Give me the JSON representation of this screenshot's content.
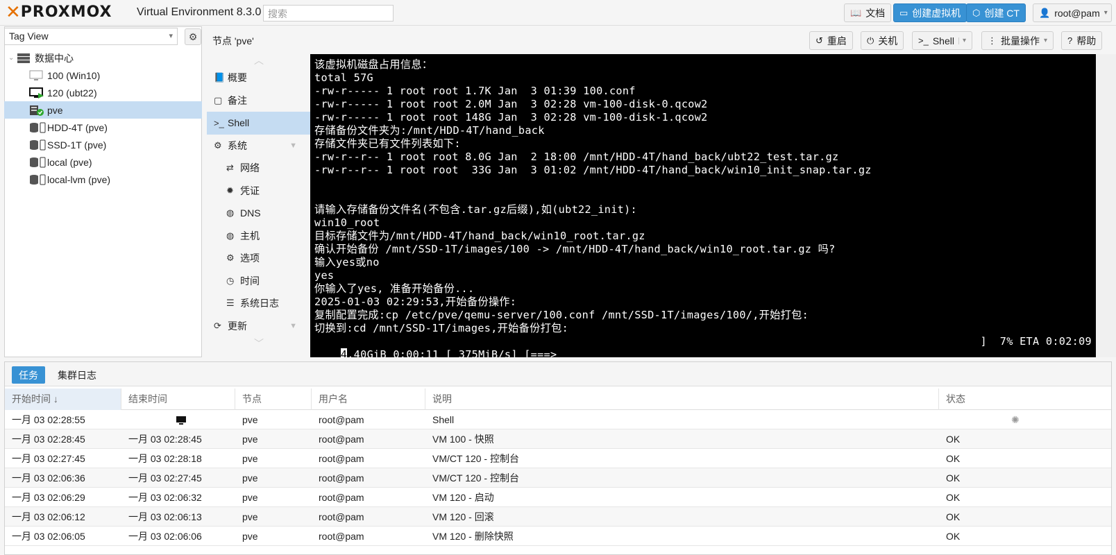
{
  "app": {
    "logo_text": "PROXMOX",
    "title": "Virtual Environment 8.3.0",
    "search_placeholder": "搜索"
  },
  "toolbar": {
    "docs": "文档",
    "create_vm": "创建虚拟机",
    "create_ct": "创建 CT",
    "user": "root@pam"
  },
  "left": {
    "view_select": "Tag View",
    "tree": [
      {
        "label": "数据中心",
        "icon": "datacenter-icon"
      },
      {
        "label": "100 (Win10)",
        "icon": "vm-stopped-icon"
      },
      {
        "label": "120 (ubt22)",
        "icon": "vm-running-icon"
      },
      {
        "label": "pve",
        "icon": "node-online-icon",
        "selected": true
      },
      {
        "label": "HDD-4T (pve)",
        "icon": "storage-icon"
      },
      {
        "label": "SSD-1T (pve)",
        "icon": "storage-icon"
      },
      {
        "label": "local (pve)",
        "icon": "storage-icon"
      },
      {
        "label": "local-lvm (pve)",
        "icon": "storage-icon"
      }
    ]
  },
  "node": {
    "title": "节点 'pve'",
    "buttons": {
      "reboot": "重启",
      "shutdown": "关机",
      "shell": "Shell",
      "bulk": "批量操作",
      "help": "帮助"
    }
  },
  "nav": [
    {
      "label": "概要",
      "icon": "book-icon"
    },
    {
      "label": "备注",
      "icon": "note-icon"
    },
    {
      "label": "Shell",
      "icon": "terminal-icon",
      "selected": true
    },
    {
      "label": "系统",
      "icon": "cogs-icon",
      "expand": true
    },
    {
      "label": "网络",
      "icon": "exchange-icon",
      "sub": true
    },
    {
      "label": "凭证",
      "icon": "certificate-icon",
      "sub": true
    },
    {
      "label": "DNS",
      "icon": "globe-icon",
      "sub": true
    },
    {
      "label": "主机",
      "icon": "globe-icon",
      "sub": true
    },
    {
      "label": "选项",
      "icon": "gear-icon",
      "sub": true
    },
    {
      "label": "时间",
      "icon": "clock-icon",
      "sub": true
    },
    {
      "label": "系统日志",
      "icon": "list-icon",
      "sub": true
    },
    {
      "label": "更新",
      "icon": "refresh-icon",
      "expand": true
    }
  ],
  "terminal": {
    "lines": [
      "该虚拟机磁盘占用信息：",
      "total 57G",
      "-rw-r----- 1 root root 1.7K Jan  3 01:39 100.conf",
      "-rw-r----- 1 root root 2.0M Jan  3 02:28 vm-100-disk-0.qcow2",
      "-rw-r----- 1 root root 148G Jan  3 02:28 vm-100-disk-1.qcow2",
      "存储备份文件夹为:/mnt/HDD-4T/hand_back",
      "存储文件夹已有文件列表如下:",
      "-rw-r--r-- 1 root root 8.0G Jan  2 18:00 /mnt/HDD-4T/hand_back/ubt22_test.tar.gz",
      "-rw-r--r-- 1 root root  33G Jan  3 01:02 /mnt/HDD-4T/hand_back/win10_init_snap.tar.gz",
      "",
      "",
      "请输入存储备份文件名(不包含.tar.gz后缀),如(ubt22_init):",
      "win10_root",
      "目标存储文件为/mnt/HDD-4T/hand_back/win10_root.tar.gz",
      "确认开始备份 /mnt/SSD-1T/images/100 -> /mnt/HDD-4T/hand_back/win10_root.tar.gz 吗?",
      "输入yes或no",
      "yes",
      "你输入了yes, 准备开始备份...",
      "2025-01-03 02:29:53,开始备份操作:",
      "复制配置完成:cp /etc/pve/qemu-server/100.conf /mnt/SSD-1T/images/100/,开始打包:",
      "切换到:cd /mnt/SSD-1T/images,开始备份打包:"
    ],
    "progress_cursor": "4",
    "progress_left": ".40GiB 0:00:11 [ 375MiB/s] [===>",
    "progress_right": "]  7% ETA 0:02:09"
  },
  "tasks": {
    "tabs": [
      "任务",
      "集群日志"
    ],
    "columns": [
      "开始时间 ↓",
      "结束时间",
      "节点",
      "用户名",
      "说明",
      "状态"
    ],
    "rows": [
      {
        "start": "一月 03 02:28:55",
        "end": "",
        "node": "pve",
        "user": "root@pam",
        "desc": "Shell",
        "status": ""
      },
      {
        "start": "一月 03 02:28:45",
        "end": "一月 03 02:28:45",
        "node": "pve",
        "user": "root@pam",
        "desc": "VM 100 - 快照",
        "status": "OK"
      },
      {
        "start": "一月 03 02:27:45",
        "end": "一月 03 02:28:18",
        "node": "pve",
        "user": "root@pam",
        "desc": "VM/CT 120 - 控制台",
        "status": "OK"
      },
      {
        "start": "一月 03 02:06:36",
        "end": "一月 03 02:27:45",
        "node": "pve",
        "user": "root@pam",
        "desc": "VM/CT 120 - 控制台",
        "status": "OK"
      },
      {
        "start": "一月 03 02:06:29",
        "end": "一月 03 02:06:32",
        "node": "pve",
        "user": "root@pam",
        "desc": "VM 120 - 启动",
        "status": "OK"
      },
      {
        "start": "一月 03 02:06:12",
        "end": "一月 03 02:06:13",
        "node": "pve",
        "user": "root@pam",
        "desc": "VM 120 - 回滚",
        "status": "OK"
      },
      {
        "start": "一月 03 02:06:05",
        "end": "一月 03 02:06:06",
        "node": "pve",
        "user": "root@pam",
        "desc": "VM 120 - 删除快照",
        "status": "OK"
      }
    ]
  },
  "colors": {
    "accent": "#3892d4",
    "brand": "#e57000",
    "selected": "#c5dcf2"
  }
}
